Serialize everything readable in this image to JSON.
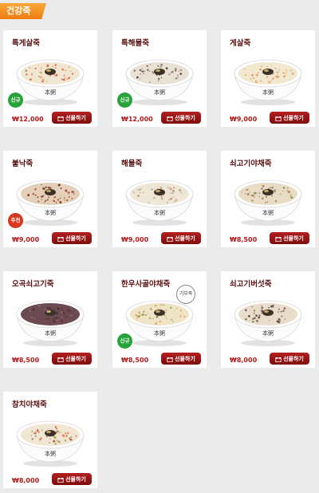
{
  "section": {
    "title": "건강죽"
  },
  "products": [
    {
      "name": "특게살죽",
      "price": "₩12,000",
      "gift_label": "선물하기",
      "badge": "신규",
      "sticker": "",
      "toppings": "seafood"
    },
    {
      "name": "특해물죽",
      "price": "₩12,000",
      "gift_label": "선물하기",
      "badge": "신규",
      "sticker": "",
      "toppings": "shell"
    },
    {
      "name": "게살죽",
      "price": "₩9,000",
      "gift_label": "선물하기",
      "badge": "",
      "sticker": "",
      "toppings": "crab"
    },
    {
      "name": "불낙죽",
      "price": "₩9,000",
      "gift_label": "선물하기",
      "badge": "추천",
      "sticker": "",
      "toppings": "meat"
    },
    {
      "name": "해물죽",
      "price": "₩9,000",
      "gift_label": "선물하기",
      "badge": "",
      "sticker": "",
      "toppings": "seafood-light"
    },
    {
      "name": "쇠고기야채죽",
      "price": "₩8,500",
      "gift_label": "선물하기",
      "badge": "",
      "sticker": "",
      "toppings": "veg"
    },
    {
      "name": "오곡쇠고기죽",
      "price": "₩8,500",
      "gift_label": "선물하기",
      "badge": "",
      "sticker": "",
      "toppings": "grain"
    },
    {
      "name": "한우사골야채죽",
      "price": "₩8,500",
      "gift_label": "선물하기",
      "badge": "신규",
      "sticker": "기부죽",
      "toppings": "veg-light"
    },
    {
      "name": "쇠고기버섯죽",
      "price": "₩8,000",
      "gift_label": "선물하기",
      "badge": "",
      "sticker": "",
      "toppings": "mushroom"
    },
    {
      "name": "참치야채죽",
      "price": "₩8,000",
      "gift_label": "선물하기",
      "badge": "",
      "sticker": "",
      "toppings": "tuna"
    }
  ],
  "colors": {
    "badge_new": "#27a33a",
    "badge_recommend": "#d8361d",
    "gift_button": "#9b1717",
    "price": "#b11a1a"
  }
}
